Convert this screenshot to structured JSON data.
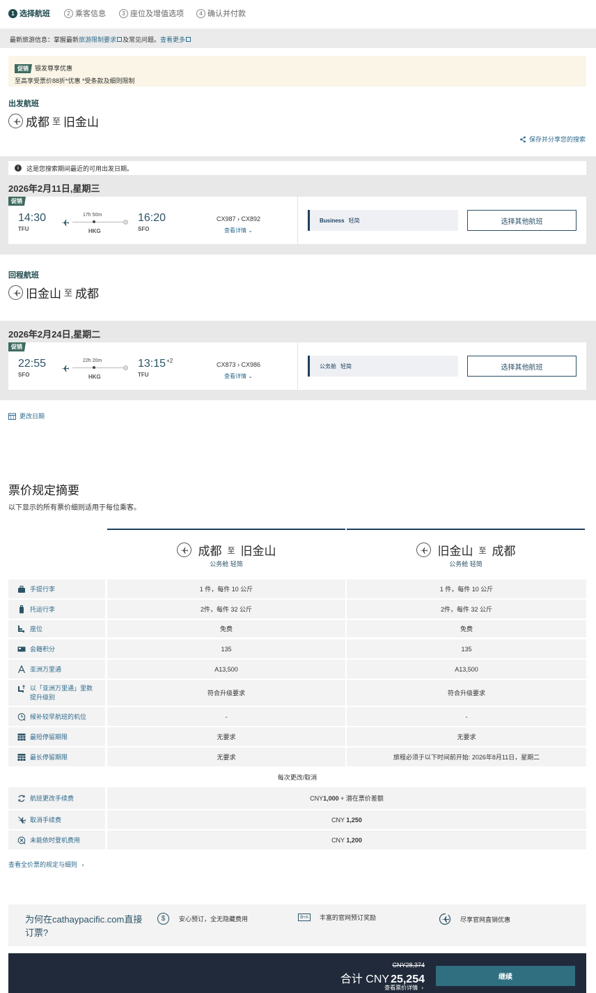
{
  "steps": [
    {
      "num": "1",
      "label": "选择航班"
    },
    {
      "num": "2",
      "label": "乘客信息"
    },
    {
      "num": "3",
      "label": "座位及增值选项"
    },
    {
      "num": "4",
      "label": "确认并付款"
    }
  ],
  "news": {
    "prefix": "最新旅游信息：掌握最新",
    "link1": "旅游限制要求",
    "mid": "及常见问题。",
    "link2": "查看更多"
  },
  "promo": {
    "tag": "促销",
    "title": "银发尊享优惠",
    "desc": "至高享受票价88折*优惠 *受条款及细则限制"
  },
  "outbound": {
    "section_label": "出发航班",
    "from": "成都",
    "zhi": "至",
    "to": "旧金山",
    "share": "保存并分享您的搜索",
    "info": "这是您搜索期间最近的可用出发日期。",
    "date": "2026年2月11日,星期三",
    "tag": "促销",
    "dep_time": "14:30",
    "dep_code": "TFU",
    "duration": "17h 50m",
    "via": "HKG",
    "arr_time": "16:20",
    "arr_plus": "",
    "arr_code": "SFO",
    "flight1": "CX987",
    "flight2": "CX892",
    "details": "查看详情",
    "cabin_class": "Business",
    "cabin_fare": "轻简",
    "select": "选择其他航班"
  },
  "inbound": {
    "section_label": "回程航班",
    "from": "旧金山",
    "zhi": "至",
    "to": "成都",
    "date": "2026年2月24日,星期二",
    "tag": "促销",
    "dep_time": "22:55",
    "dep_code": "SFO",
    "duration": "22h 20m",
    "via": "HKG",
    "arr_time": "13:15",
    "arr_plus": "+2",
    "arr_code": "TFU",
    "flight1": "CX873",
    "flight2": "CX986",
    "details": "查看详情",
    "cabin_class": "公务舱",
    "cabin_fare": "轻简",
    "select": "选择其他航班"
  },
  "change_date": "更改日期",
  "fare": {
    "title": "票价规定摘要",
    "subtitle": "以下显示的所有票价细则适用于每位乘客。",
    "col1": {
      "from": "成都",
      "zhi": "至",
      "to": "旧金山",
      "cabin": "公务舱 轻简"
    },
    "col2": {
      "from": "旧金山",
      "zhi": "至",
      "to": "成都",
      "cabin": "公务舱 轻简"
    },
    "rows": [
      {
        "label": "手提行李",
        "icon": "carry-on-bag-icon",
        "v1": "1 件，每件 10 公斤",
        "v2": "1 件，每件 10 公斤"
      },
      {
        "label": "托运行李",
        "icon": "checked-bag-icon",
        "v1": "2件，每件 32 公斤",
        "v2": "2件，每件 32 公斤"
      },
      {
        "label": "座位",
        "icon": "seat-icon",
        "v1": "免费",
        "v2": "免费"
      },
      {
        "label": "会籍积分",
        "icon": "status-card-icon",
        "v1": "135",
        "v2": "135"
      },
      {
        "label": "亚洲万里通",
        "icon": "asia-miles-icon",
        "v1": "A13,500",
        "v2": "A13,500"
      },
      {
        "label": "以「亚洲万里通」里数提升级别",
        "icon": "upgrade-seat-icon",
        "v1": "符合升级要求",
        "v2": "符合升级要求"
      },
      {
        "label": "候补较早航班的机位",
        "icon": "standby-icon",
        "v1": "-",
        "v2": "-"
      },
      {
        "label": "最短停留期限",
        "icon": "calendar-min-icon",
        "v1": "无要求",
        "v2": "无要求"
      },
      {
        "label": "最长停留期限",
        "icon": "calendar-max-icon",
        "v1": "无要求",
        "v2": "旅程必须于以下时间前开始: 2026年8月11日，星期二"
      }
    ],
    "per_change": "每次更改/取消",
    "fee_rows": [
      {
        "label": "航班更改手续费",
        "icon": "refresh-icon",
        "value_prefix": "CNY",
        "value_bold": "1,000",
        "value_suffix": " + 潜在票价差额"
      },
      {
        "label": "取消手续费",
        "icon": "cancel-flight-icon",
        "value_prefix": "CNY ",
        "value_bold": "1,250",
        "value_suffix": ""
      },
      {
        "label": "未能依时登机费用",
        "icon": "no-show-icon",
        "value_prefix": "CNY ",
        "value_bold": "1,200",
        "value_suffix": ""
      }
    ],
    "all_rules": "查看全价票的规定与细则"
  },
  "why": {
    "title": "为何在cathaypacific.com直接订票?",
    "items": [
      {
        "icon": "dollar-icon",
        "label": "安心预订，全无隐藏费用"
      },
      {
        "icon": "ticket-icon",
        "label": "丰富的官网预订奖励"
      },
      {
        "icon": "sale-plane-icon",
        "label": "尽享官网直销优惠"
      }
    ]
  },
  "footer": {
    "old_price": "CNY28,374",
    "total_label": "合计 CNY",
    "total_value": "25,254",
    "view_details": "查看票价详情",
    "continue": "继续"
  },
  "colors": {
    "accent": "#1f4a4d",
    "link": "#2e6b8d",
    "navy": "#1f3f5f",
    "footer": "#202a3a",
    "button": "#2f6f80"
  }
}
